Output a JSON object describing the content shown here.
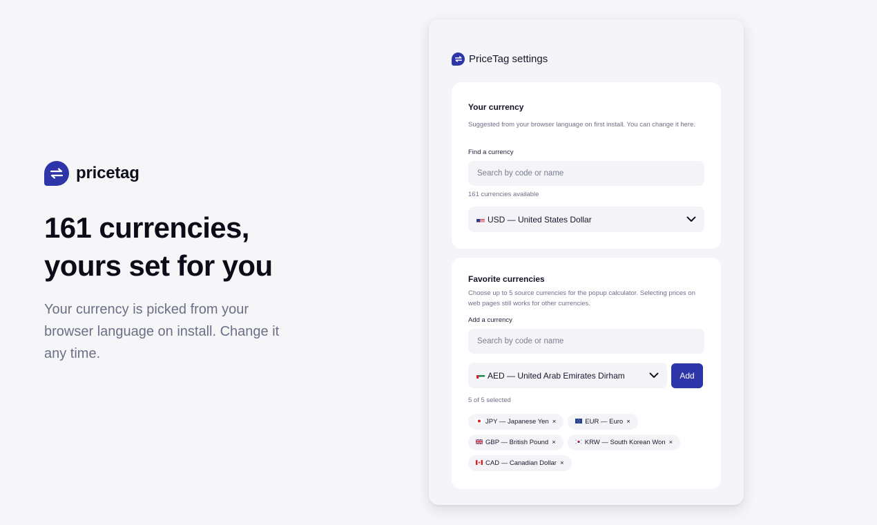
{
  "hero": {
    "brand_name": "pricetag",
    "headline_line1": "161 currencies,",
    "headline_line2": "yours set for you",
    "subtitle": "Your currency is picked from your browser language on install. Change it any time."
  },
  "window": {
    "title": "PriceTag settings"
  },
  "your_currency": {
    "title": "Your currency",
    "description": "Suggested from your browser language on first install. You can change it here.",
    "find_label": "Find a currency",
    "search_placeholder": "Search by code or name",
    "available_text": "161 currencies available",
    "selected_value": "USD — United States Dollar",
    "selected_flag": "US flag"
  },
  "favorites": {
    "title": "Favorite currencies",
    "description": "Choose up to 5 source currencies for the popup calculator. Selecting prices on web pages still works for other currencies.",
    "add_label": "Add a currency",
    "search_placeholder": "Search by code or name",
    "selected_value": "AED — United Arab Emirates Dirham",
    "selected_flag": "UAE flag",
    "add_button": "Add",
    "count_text": "5 of 5 selected",
    "chips": [
      {
        "label": "JPY — Japanese Yen",
        "remove": "×",
        "flag": "JP"
      },
      {
        "label": "EUR — Euro",
        "remove": "×",
        "flag": "EU"
      },
      {
        "label": "GBP — British Pound",
        "remove": "×",
        "flag": "GB"
      },
      {
        "label": "KRW — South Korean Won",
        "remove": "×",
        "flag": "KR"
      },
      {
        "label": "CAD — Canadian Dollar",
        "remove": "×",
        "flag": "CA"
      }
    ]
  },
  "colors": {
    "accent": "#2e35a8",
    "background": "#f6f6f9",
    "card": "#ffffff",
    "muted_text": "#6b6f86"
  },
  "icons": {
    "logo": "swap-arrows-icon",
    "dropdown": "chevron-down-icon"
  }
}
